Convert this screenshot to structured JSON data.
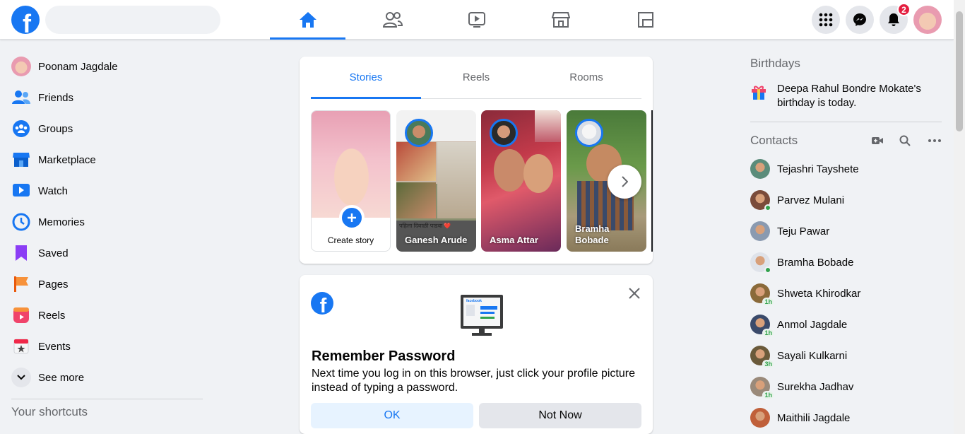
{
  "topbar": {
    "search_placeholder": "",
    "notification_count": "2",
    "nav": [
      "Home",
      "Friends",
      "Watch",
      "Marketplace",
      "Gaming"
    ]
  },
  "left": {
    "items": [
      {
        "label": "Poonam Jagdale",
        "icon": "profile-avatar"
      },
      {
        "label": "Friends",
        "icon": "friends-icon"
      },
      {
        "label": "Groups",
        "icon": "groups-icon"
      },
      {
        "label": "Marketplace",
        "icon": "marketplace-icon"
      },
      {
        "label": "Watch",
        "icon": "watch-icon"
      },
      {
        "label": "Memories",
        "icon": "memories-icon"
      },
      {
        "label": "Saved",
        "icon": "saved-icon"
      },
      {
        "label": "Pages",
        "icon": "pages-icon"
      },
      {
        "label": "Reels",
        "icon": "reels-icon"
      },
      {
        "label": "Events",
        "icon": "events-icon"
      },
      {
        "label": "See more",
        "icon": "chevron-down-icon"
      }
    ],
    "shortcuts_title": "Your shortcuts"
  },
  "stories": {
    "tabs": [
      "Stories",
      "Reels",
      "Rooms"
    ],
    "create_label": "Create story",
    "items": [
      {
        "name": "Ganesh Arude",
        "caption": "पहिला दिवाळी पाडवा ❤️"
      },
      {
        "name": "Asma Attar"
      },
      {
        "name": "Bramha\nBobade"
      }
    ]
  },
  "password_card": {
    "title": "Remember Password",
    "body": "Next time you log in on this browser, just click your profile picture instead of typing a password.",
    "ok_label": "OK",
    "not_now_label": "Not Now",
    "illustration_text": "facebook"
  },
  "birthdays": {
    "title": "Birthdays",
    "name": "Deepa Rahul Bondre Mokate",
    "suffix": "'s",
    "text": "birthday is today."
  },
  "contacts": {
    "title": "Contacts",
    "list": [
      {
        "name": "Tejashri Tayshete",
        "status": "none",
        "color": "#5b8c7a"
      },
      {
        "name": "Parvez Mulani",
        "status": "online",
        "color": "#7a4b3a"
      },
      {
        "name": "Teju Pawar",
        "status": "none",
        "color": "#8a9ab0"
      },
      {
        "name": "Bramha Bobade",
        "status": "online",
        "color": "#dfe3ea"
      },
      {
        "name": "Shweta Khirodkar",
        "status": "1h",
        "color": "#8a6a3a"
      },
      {
        "name": "Anmol Jagdale",
        "status": "1h",
        "color": "#3a4a6a"
      },
      {
        "name": "Sayali Kulkarni",
        "status": "3h",
        "color": "#6a5a3a"
      },
      {
        "name": "Surekha Jadhav",
        "status": "1h",
        "color": "#9a8a7a"
      },
      {
        "name": "Maithili Jagdale",
        "status": "none",
        "color": "#c0603a"
      }
    ]
  }
}
